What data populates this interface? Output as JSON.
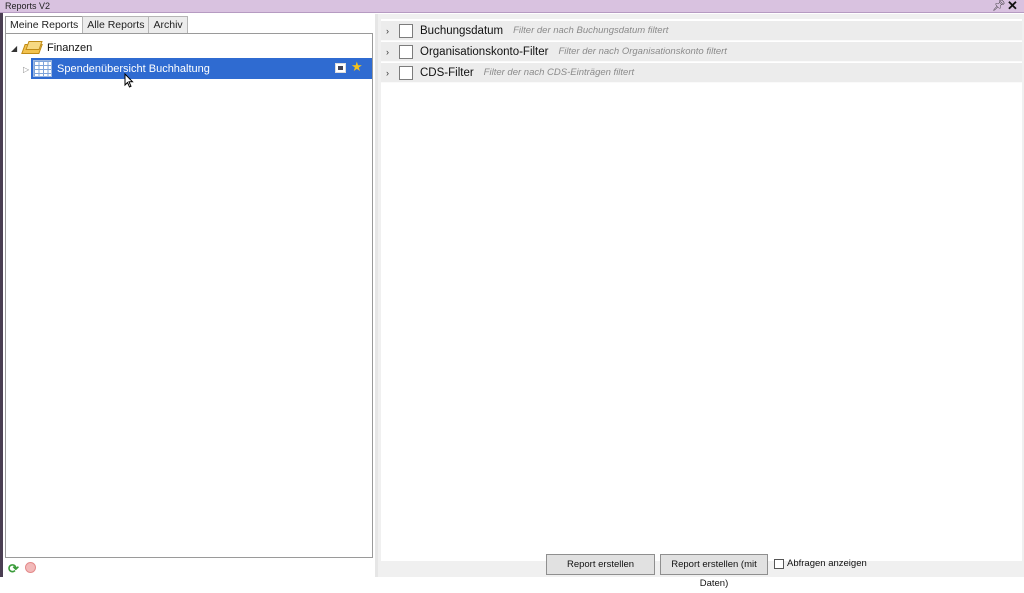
{
  "window": {
    "title": "Reports V2",
    "pin_icon": "pin-icon",
    "close_icon": "close-icon"
  },
  "tabs": [
    {
      "label": "Meine Reports",
      "active": true
    },
    {
      "label": "Alle Reports",
      "active": false
    },
    {
      "label": "Archiv",
      "active": false
    }
  ],
  "tree": {
    "folder": {
      "label": "Finanzen",
      "icon": "folder-icon",
      "expanded": true
    },
    "report": {
      "label": "Spendenübersicht Buchhaltung",
      "icon": "table-icon",
      "selected": true,
      "favorite": true
    }
  },
  "filters": [
    {
      "name": "Buchungsdatum",
      "description": "Filter der nach Buchungsdatum filtert",
      "checked": false
    },
    {
      "name": "Organisationskonto-Filter",
      "description": "Filter der nach Organisationskonto filtert",
      "checked": false
    },
    {
      "name": "CDS-Filter",
      "description": "Filter der nach CDS-Einträgen filtert",
      "checked": false
    }
  ],
  "actions": {
    "create_report": "Report erstellen",
    "create_report_with_data": "Report erstellen (mit Daten)",
    "show_queries": "Abfragen anzeigen"
  },
  "colors": {
    "selection": "#2f6bd1",
    "titlebar": "#d9c2e0",
    "star": "#f5c21b"
  }
}
